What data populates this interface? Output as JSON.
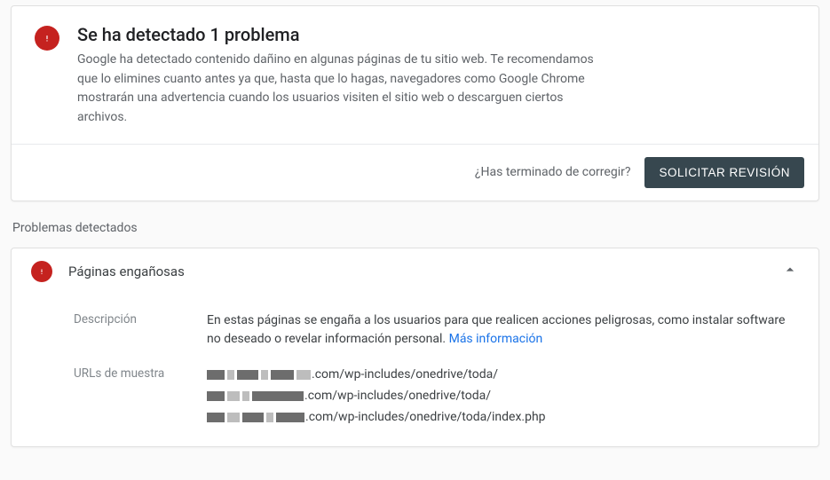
{
  "card": {
    "title": "Se ha detectado 1 problema",
    "description": "Google ha detectado contenido dañino en algunas páginas de tu sitio web. Te recomendamos que lo elimines cuanto antes ya que, hasta que lo hagas, navegadores como Google Chrome mostrarán una advertencia cuando los usuarios visiten el sitio web o descarguen ciertos archivos.",
    "prompt": "¿Has terminado de corregir?",
    "button": "SOLICITAR REVISIÓN"
  },
  "section_label": "Problemas detectados",
  "panel": {
    "title": "Páginas engañosas",
    "desc_label": "Descripción",
    "desc": "En estas páginas se engaña a los usuarios para que realicen acciones peligrosas, como instalar software no deseado o revelar información personal. ",
    "more_info": "Más información",
    "urls_label": "URLs de muestra",
    "url_suffix_1": ".com/wp-includes/onedrive/toda/",
    "url_suffix_2": ".com/wp-includes/onedrive/toda/",
    "url_suffix_3": ".com/wp-includes/onedrive/toda/index.php"
  }
}
